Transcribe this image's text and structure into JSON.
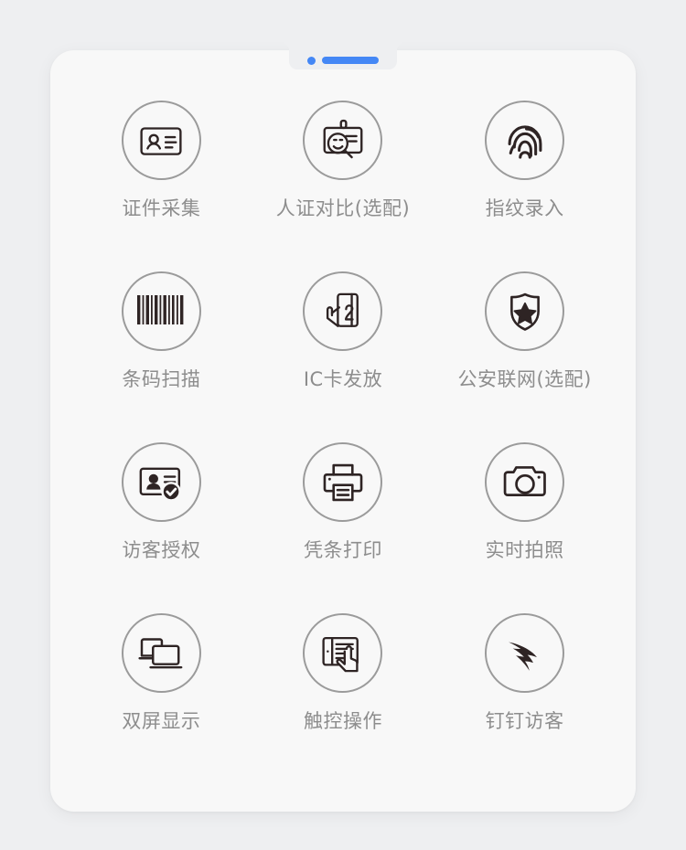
{
  "page": {
    "background_color": "#eeeff1",
    "card_color": "#f8f8f8"
  },
  "device": {
    "notch": {
      "camera_indicator": "camera-dot",
      "speaker_bar": "speaker-bar",
      "accent_color": "#4487f5"
    }
  },
  "features": {
    "icon_stroke_color": "#2e2424",
    "circle_border_color": "#9b9b9b",
    "label_color": "#8d8d8d",
    "items": [
      {
        "label": "证件采集",
        "icon": "id-card-person-icon"
      },
      {
        "label": "人证对比(选配)",
        "icon": "badge-magnifier-icon"
      },
      {
        "label": "指纹录入",
        "icon": "fingerprint-icon"
      },
      {
        "label": "条码扫描",
        "icon": "barcode-icon"
      },
      {
        "label": "IC卡发放",
        "icon": "hand-card-icon"
      },
      {
        "label": "公安联网(选配)",
        "icon": "shield-star-icon"
      },
      {
        "label": "访客授权",
        "icon": "id-card-check-icon"
      },
      {
        "label": "凭条打印",
        "icon": "printer-icon"
      },
      {
        "label": "实时拍照",
        "icon": "camera-icon"
      },
      {
        "label": "双屏显示",
        "icon": "dual-screen-icon"
      },
      {
        "label": "触控操作",
        "icon": "touch-tablet-icon"
      },
      {
        "label": "钉钉访客",
        "icon": "dingtalk-wing-icon"
      }
    ]
  }
}
